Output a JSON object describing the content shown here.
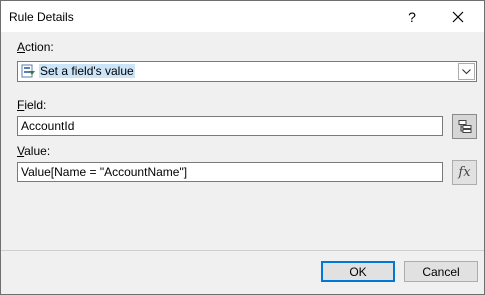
{
  "window": {
    "title": "Rule Details"
  },
  "titlebar": {
    "help": "?",
    "close": "✕"
  },
  "action": {
    "label_hot": "A",
    "label_rest": "ction:",
    "value": "Set a field's value"
  },
  "field": {
    "label_hot": "F",
    "label_rest": "ield:",
    "value": "AccountId"
  },
  "value_field": {
    "label_hot": "V",
    "label_rest": "alue:",
    "value": "Value[Name = \"AccountName\"]",
    "fx": "fx"
  },
  "buttons": {
    "ok": "OK",
    "cancel": "Cancel"
  },
  "icons": {
    "combo": "set-field-value-icon",
    "field_picker": "field-picker-icon",
    "formula": "fx-icon",
    "dropdown": "chevron-down-icon"
  }
}
